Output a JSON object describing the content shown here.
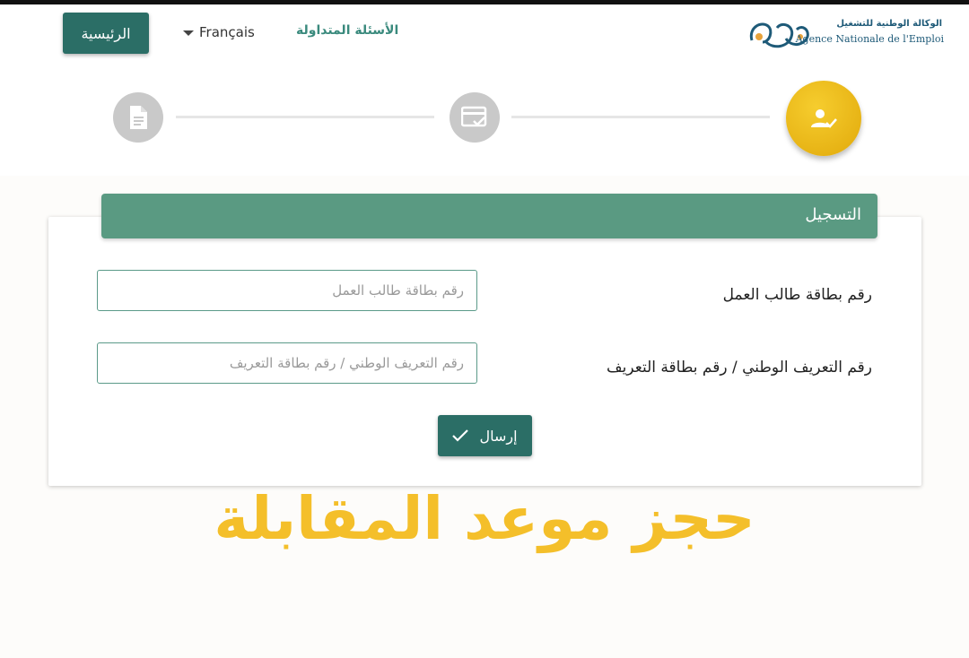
{
  "navbar": {
    "home_label": "الرئيسية",
    "language_label": "Français",
    "faq_label": "الأسئلة المتداولة",
    "logo": {
      "arabic_name": "الوكالة الوطنية للتشغيل",
      "french_name": "Agence Nationale de l'Emploi"
    }
  },
  "stepper": {
    "steps": [
      {
        "icon": "document-icon",
        "state": "inactive"
      },
      {
        "icon": "card-check-icon",
        "state": "inactive"
      },
      {
        "icon": "user-check-icon",
        "state": "active"
      }
    ]
  },
  "form": {
    "title": "التسجيل",
    "fields": [
      {
        "label": "رقم بطاقة طالب العمل",
        "placeholder": "رقم بطاقة طالب العمل",
        "value": ""
      },
      {
        "label": "رقم التعريف الوطني / رقم بطاقة التعريف",
        "placeholder": "رقم التعريف الوطني / رقم بطاقة التعريف",
        "value": ""
      }
    ],
    "submit_label": "إرسال"
  },
  "overlay_text": "حجز موعد المقابلة",
  "colors": {
    "primary": "#2b6e66",
    "header": "#5a9a82",
    "accent": "#f4bf2a",
    "active_step": "#e8b415",
    "inactive_step": "#c9c9c9"
  }
}
